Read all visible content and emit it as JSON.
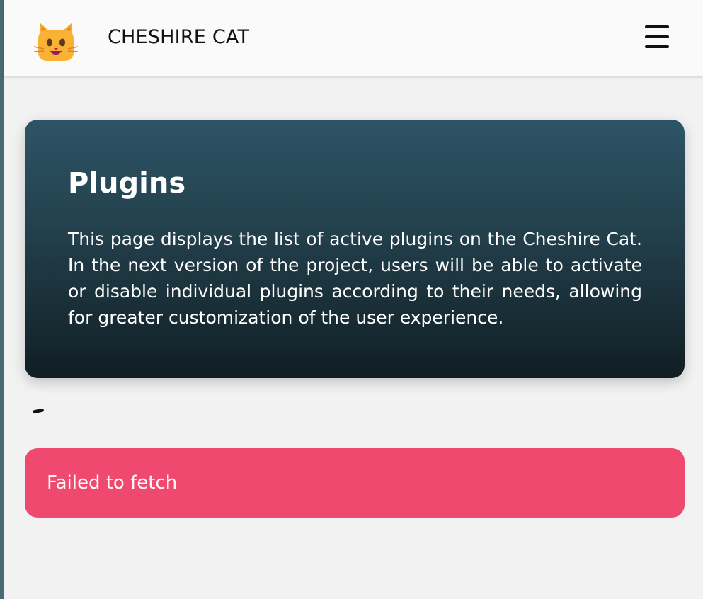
{
  "header": {
    "app_title": "CHESHIRE CAT",
    "logo_icon": "cat-face-icon",
    "menu_icon": "hamburger-menu-icon"
  },
  "hero": {
    "title": "Plugins",
    "description": "This page displays the list of active plugins on the Cheshire Cat. In the next version of the project, users will be able to activate or disable individual plugins according to their needs, allowing for greater customization of the user experience."
  },
  "error": {
    "message": "Failed to fetch"
  },
  "colors": {
    "page_background": "#f2f2f2",
    "header_background": "#fafafa",
    "hero_gradient_top": "#2d5466",
    "hero_gradient_bottom": "#111e24",
    "error_background": "#f0496f",
    "logo_orange": "#f9a825"
  }
}
